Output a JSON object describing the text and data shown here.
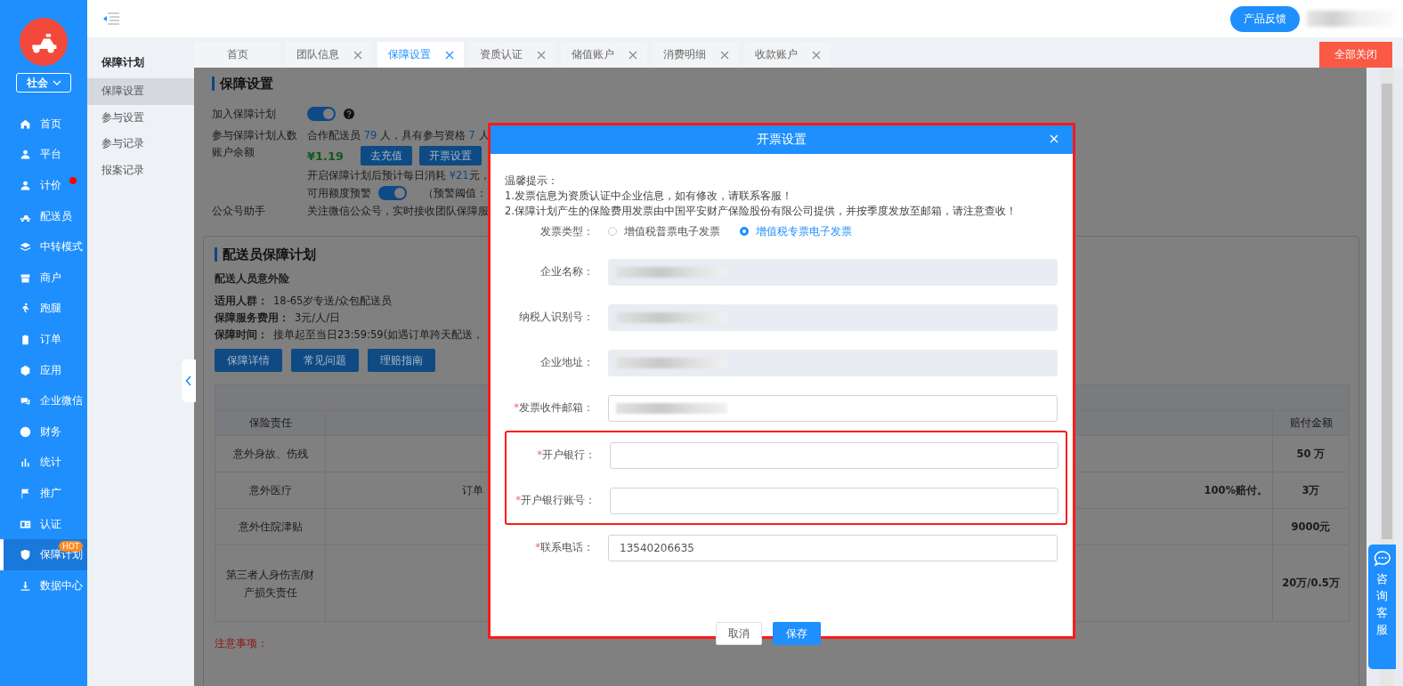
{
  "sidebar": {
    "org_select": "社会",
    "items": [
      {
        "label": "首页",
        "selected": false,
        "dot": false
      },
      {
        "label": "平台",
        "selected": false,
        "dot": false
      },
      {
        "label": "计价",
        "selected": false,
        "dot": true
      },
      {
        "label": "配送员",
        "selected": false,
        "dot": false
      },
      {
        "label": "中转模式",
        "selected": false,
        "dot": false
      },
      {
        "label": "商户",
        "selected": false,
        "dot": false
      },
      {
        "label": "跑腿",
        "selected": false,
        "dot": false
      },
      {
        "label": "订单",
        "selected": false,
        "dot": false
      },
      {
        "label": "应用",
        "selected": false,
        "dot": false
      },
      {
        "label": "企业微信",
        "selected": false,
        "dot": false
      },
      {
        "label": "财务",
        "selected": false,
        "dot": false
      },
      {
        "label": "统计",
        "selected": false,
        "dot": false
      },
      {
        "label": "推广",
        "selected": false,
        "dot": false
      },
      {
        "label": "认证",
        "selected": false,
        "dot": false
      },
      {
        "label": "保障计划",
        "selected": true,
        "dot": false,
        "badge": "HOT"
      },
      {
        "label": "数据中心",
        "selected": false,
        "dot": false
      }
    ]
  },
  "topbar": {
    "feedback_button": "产品反馈"
  },
  "submenu": {
    "title": "保障计划",
    "items": [
      {
        "label": "保障设置",
        "selected": true
      },
      {
        "label": "参与设置",
        "selected": false
      },
      {
        "label": "参与记录",
        "selected": false
      },
      {
        "label": "报案记录",
        "selected": false
      }
    ]
  },
  "tabs": [
    {
      "label": "首页",
      "selected": false,
      "closable": false
    },
    {
      "label": "团队信息",
      "selected": false,
      "closable": true
    },
    {
      "label": "保障设置",
      "selected": true,
      "closable": true
    },
    {
      "label": "资质认证",
      "selected": false,
      "closable": true
    },
    {
      "label": "储值账户",
      "selected": false,
      "closable": true
    },
    {
      "label": "消费明细",
      "selected": false,
      "closable": true
    },
    {
      "label": "收款账户",
      "selected": false,
      "closable": true
    }
  ],
  "close_all_button": "全部关闭",
  "settings": {
    "title": "保障设置",
    "join": {
      "label": "加入保障计划",
      "on": true
    },
    "participants": {
      "label": "参与保障计划人数",
      "segments": [
        {
          "text": "合作配送员 ",
          "highlight": false
        },
        {
          "text": "79",
          "highlight": true
        },
        {
          "text": " 人，具有参与资格 ",
          "highlight": false
        },
        {
          "text": "7",
          "highlight": true
        },
        {
          "text": " 人",
          "highlight": false
        }
      ]
    },
    "balance": {
      "label": "账户余额",
      "amount": "¥1.19",
      "buttons": [
        "去充值",
        "开票设置"
      ],
      "note_segments": [
        {
          "text": "开启保障计划后预计每日消耗 ",
          "highlight": false
        },
        {
          "text": "¥21",
          "highlight": true
        },
        {
          "text": "元，",
          "highlight": false
        }
      ],
      "alert": {
        "label": "可用额度预警",
        "on": true,
        "threshold": "（预警阈值："
      }
    },
    "wechat": {
      "label": "公众号助手",
      "text": "关注微信公众号，实时接收团队保障服"
    }
  },
  "plan": {
    "title": "配送员保障计划",
    "product": "配送人员意外险",
    "details": [
      {
        "label": "适用人群：",
        "value": "18-65岁专送/众包配送员"
      },
      {
        "label": "保障服务费用：",
        "value": "3元/人/日"
      },
      {
        "label": "保障时间：",
        "value": "接单起至当日23:59:59(如遇订单跨天配送，"
      }
    ],
    "buttons": [
      "保障详情",
      "常见问题",
      "理赔指南"
    ],
    "table": {
      "liability_header": "保险责任",
      "amount_header": "赔付金额",
      "rows": [
        {
          "liability": "意外身故、伤残",
          "amount": "50 万"
        },
        {
          "liability": "意外医疗",
          "detail_left": "订单",
          "detail_right": "100%赔付。",
          "amount": "3万"
        },
        {
          "liability": "意外住院津贴",
          "amount": "9000元"
        },
        {
          "liability": "第三者人身伤害/财产损失责任",
          "amount": "20万/0.5万"
        }
      ]
    },
    "notice_title": "注意事项："
  },
  "dialog": {
    "title": "开票设置",
    "tips": [
      "温馨提示：",
      "1.发票信息为资质认证中企业信息，如有修改，请联系客服！",
      "2.保障计划产生的保险费用发票由中国平安财产保险股份有限公司提供，并按季度发放至邮箱，请注意查收！"
    ],
    "invoice_type": {
      "label": "发票类型：",
      "options": [
        {
          "label": "增值税普票电子发票",
          "selected": false
        },
        {
          "label": "增值税专票电子发票",
          "selected": true
        }
      ]
    },
    "fields": [
      {
        "label": "企业名称：",
        "disabled": true,
        "redacted": true,
        "highlighted": false
      },
      {
        "label": "纳税人识别号：",
        "disabled": true,
        "redacted": true,
        "highlighted": false
      },
      {
        "label": "企业地址：",
        "disabled": true,
        "redacted": true,
        "highlighted": false
      },
      {
        "label": "发票收件邮箱：",
        "required_mark": "*",
        "disabled": false,
        "redacted": true,
        "highlighted": false
      },
      {
        "label": "开户银行：",
        "required_mark": "*",
        "disabled": false,
        "redacted": false,
        "highlighted": true
      },
      {
        "label": "开户银行账号：",
        "required_mark": "*",
        "disabled": false,
        "redacted": false,
        "highlighted": true
      },
      {
        "label": "联系电话：",
        "required_mark": "*",
        "disabled": false,
        "redacted": false,
        "highlighted": false,
        "value": "13540206635"
      }
    ],
    "buttons": [
      {
        "label": "取消",
        "kind": "default"
      },
      {
        "label": "保存",
        "kind": "primary"
      }
    ]
  },
  "chat_button": {
    "label": "咨询客服"
  }
}
